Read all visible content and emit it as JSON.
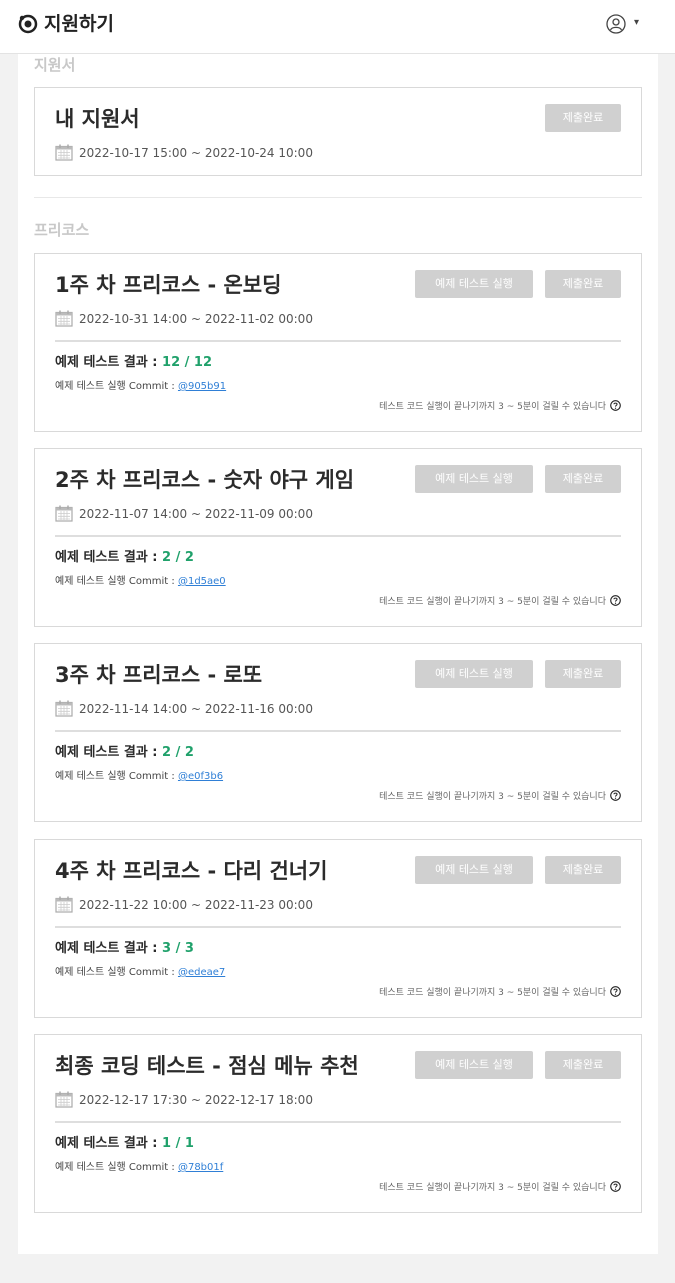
{
  "header": {
    "title": "지원하기",
    "logo_icon": "logo-icon",
    "caret": "▾"
  },
  "sections": {
    "application": {
      "title": "지원서",
      "card": {
        "title": "내 지원서",
        "date": "2022-10-17 15:00 ~ 2022-10-24 10:00",
        "status_label": "제출완료"
      }
    },
    "precourse": {
      "title": "프리코스"
    }
  },
  "labels": {
    "run_button": "예제 테스트 실행",
    "status": "제출완료",
    "result_prefix": "예제 테스트 결과 : ",
    "commit_prefix": "예제 테스트 실행 Commit : ",
    "note": "테스트 코드 실행이 끝나기까지 3 ~ 5분이 걸릴 수 있습니다"
  },
  "missions": [
    {
      "title": "1주 차 프리코스 - 온보딩",
      "date": "2022-10-31 14:00 ~ 2022-11-02 00:00",
      "score": "12 / 12",
      "commit": "@905b91"
    },
    {
      "title": "2주 차 프리코스 - 숫자 야구 게임",
      "date": "2022-11-07 14:00 ~ 2022-11-09 00:00",
      "score": "2 / 2",
      "commit": "@1d5ae0"
    },
    {
      "title": "3주 차 프리코스 - 로또",
      "date": "2022-11-14 14:00 ~ 2022-11-16 00:00",
      "score": "2 / 2",
      "commit": "@e0f3b6"
    },
    {
      "title": "4주 차 프리코스 - 다리 건너기",
      "date": "2022-11-22 10:00 ~ 2022-11-23 00:00",
      "score": "3 / 3",
      "commit": "@edeae7"
    },
    {
      "title": "최종 코딩 테스트 - 점심 메뉴 추천",
      "date": "2022-12-17 17:30 ~ 2022-12-17 18:00",
      "score": "1 / 1",
      "commit": "@78b01f"
    }
  ],
  "colors": {
    "score": "#20a16b",
    "link": "#2f7fd6",
    "button_disabled": "#d0d0d0"
  }
}
